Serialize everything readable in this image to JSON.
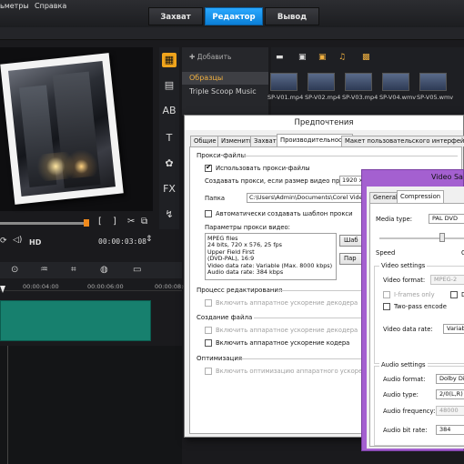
{
  "header": {
    "tabs": [
      {
        "label": "Захват",
        "active": false
      },
      {
        "label": "Редактор",
        "active": true
      },
      {
        "label": "Вывод",
        "active": false
      }
    ],
    "accent": "#1e96ee"
  },
  "menubar": {
    "items": [
      "ьметры",
      "Справка"
    ]
  },
  "player": {
    "quality": "HD",
    "timecode": "00:00:03:08",
    "progress": 0.57
  },
  "library": {
    "add_label": "Добавить",
    "items": [
      {
        "label": "Образцы",
        "selected": true
      },
      {
        "label": "Triple Scoop Music",
        "selected": false
      }
    ],
    "thumbnails": [
      "SP-V01.mp4",
      "SP-V02.mp4",
      "SP-V03.mp4",
      "SP-V04.wmv",
      "SP-V05.wmv"
    ]
  },
  "timeline": {
    "ruler": [
      "00:00:04:00",
      "00:00:06:00",
      "00:00:08:00"
    ]
  },
  "preferences": {
    "title": "Предпочтения",
    "tabs": [
      "Общие",
      "Изменить",
      "Захват",
      "Производительность",
      "Макет пользовательского интерфейса"
    ],
    "active_tab": "Производительность",
    "proxy_section": "Прокси-файлы",
    "use_proxy_label": "Использовать прокси-файлы",
    "create_proxy_label": "Создавать прокси, если размер видео превышает",
    "proxy_size_value": "1920 x",
    "folder_label": "Папка",
    "folder_value": "C:\\Users\\Admin\\Documents\\Corel VideoStu",
    "auto_template_label": "Автоматически создавать шаблон прокси",
    "params_label": "Параметры прокси видео:",
    "params_lines": [
      "MPEG files",
      "24 bits, 720 x 576, 25 fps",
      "Upper Field First",
      "(DVD-PAL), 16:9",
      "Video data rate: Variable (Max.  8000 kbps)",
      "Audio data rate: 384 kbps"
    ],
    "template_button": "Шаб",
    "options_button": "Пар",
    "edit_section": "Процесс редактирования",
    "hw_decoder_label_1": "Включить аппаратное ускорение декодера",
    "file_section": "Создание файла",
    "hw_decoder_label_2": "Включить аппаратное ускорение декодера",
    "hw_encoder_label": "Включить аппаратное ускорение кодера",
    "opt_section": "Оптимизация",
    "hw_opt_label": "Включить оптимизацию аппаратного ускорения"
  },
  "video_save": {
    "title": "Video Save",
    "tabs": [
      "General",
      "Compression"
    ],
    "active_tab": "Compression",
    "media_type_label": "Media type:",
    "media_type_value": "PAL DVD",
    "speed_label": "Speed",
    "speed_right": "Q",
    "video_settings_label": "Video settings",
    "video_format_label": "Video format:",
    "video_format_value": "MPEG-2",
    "iframes_label": "I-frames only",
    "dv_label": "DV",
    "two_pass_label": "Two-pass encode",
    "video_data_rate_label": "Video data rate:",
    "video_data_rate_value": "Variable",
    "audio_settings_label": "Audio settings",
    "audio_format_label": "Audio format:",
    "audio_format_value": "Dolby Digita",
    "audio_type_label": "Audio type:",
    "audio_type_value": "2/0(L,R)",
    "audio_freq_label": "Audio frequency:",
    "audio_freq_value": "48000",
    "audio_bit_label": "Audio bit rate:",
    "audio_bit_value": "384",
    "frame_color": "#a460d0"
  }
}
